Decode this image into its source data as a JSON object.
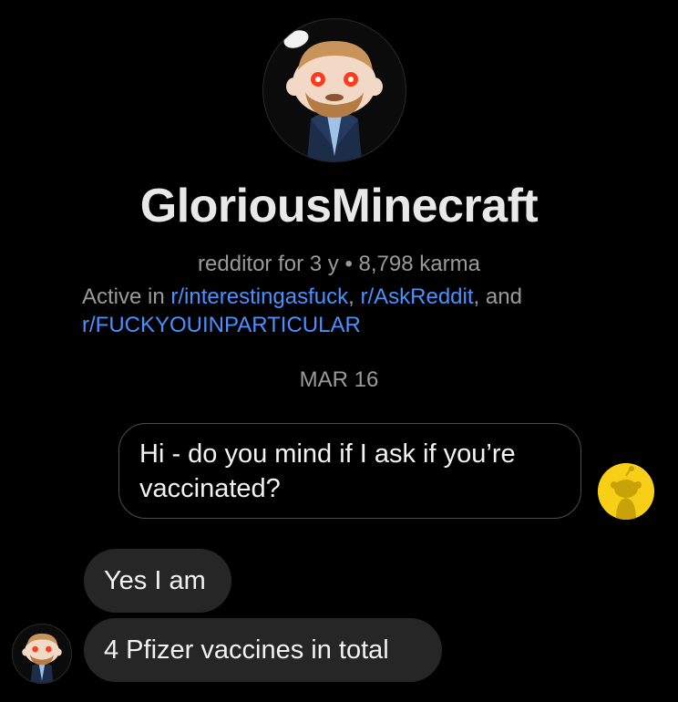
{
  "profile": {
    "username": "GloriousMinecraft",
    "meta": "redditor for 3 y • 8,798 karma",
    "active_prefix": "Active in ",
    "communities": [
      "r/interestingasfuck",
      "r/AskReddit",
      "r/FUCKYOUINPARTICULAR"
    ],
    "sep_comma": ", ",
    "sep_and": ", and"
  },
  "chat": {
    "date": "MAR 16",
    "messages": [
      {
        "sender": "self",
        "text": "Hi - do you mind if I ask if you’re vaccinated?"
      },
      {
        "sender": "other",
        "text": "Yes I am"
      },
      {
        "sender": "other",
        "text": "4 Pfizer vaccines in total"
      }
    ]
  },
  "colors": {
    "background": "#000000",
    "link": "#4a90ff",
    "bubble_incoming": "#262626",
    "self_avatar": "#f7cf17",
    "avatar_eyes": "#ff3b1f"
  },
  "icons": {
    "profile_avatar": "snoo-avatar-icon",
    "self_avatar": "snoo-yellow-avatar-icon"
  }
}
